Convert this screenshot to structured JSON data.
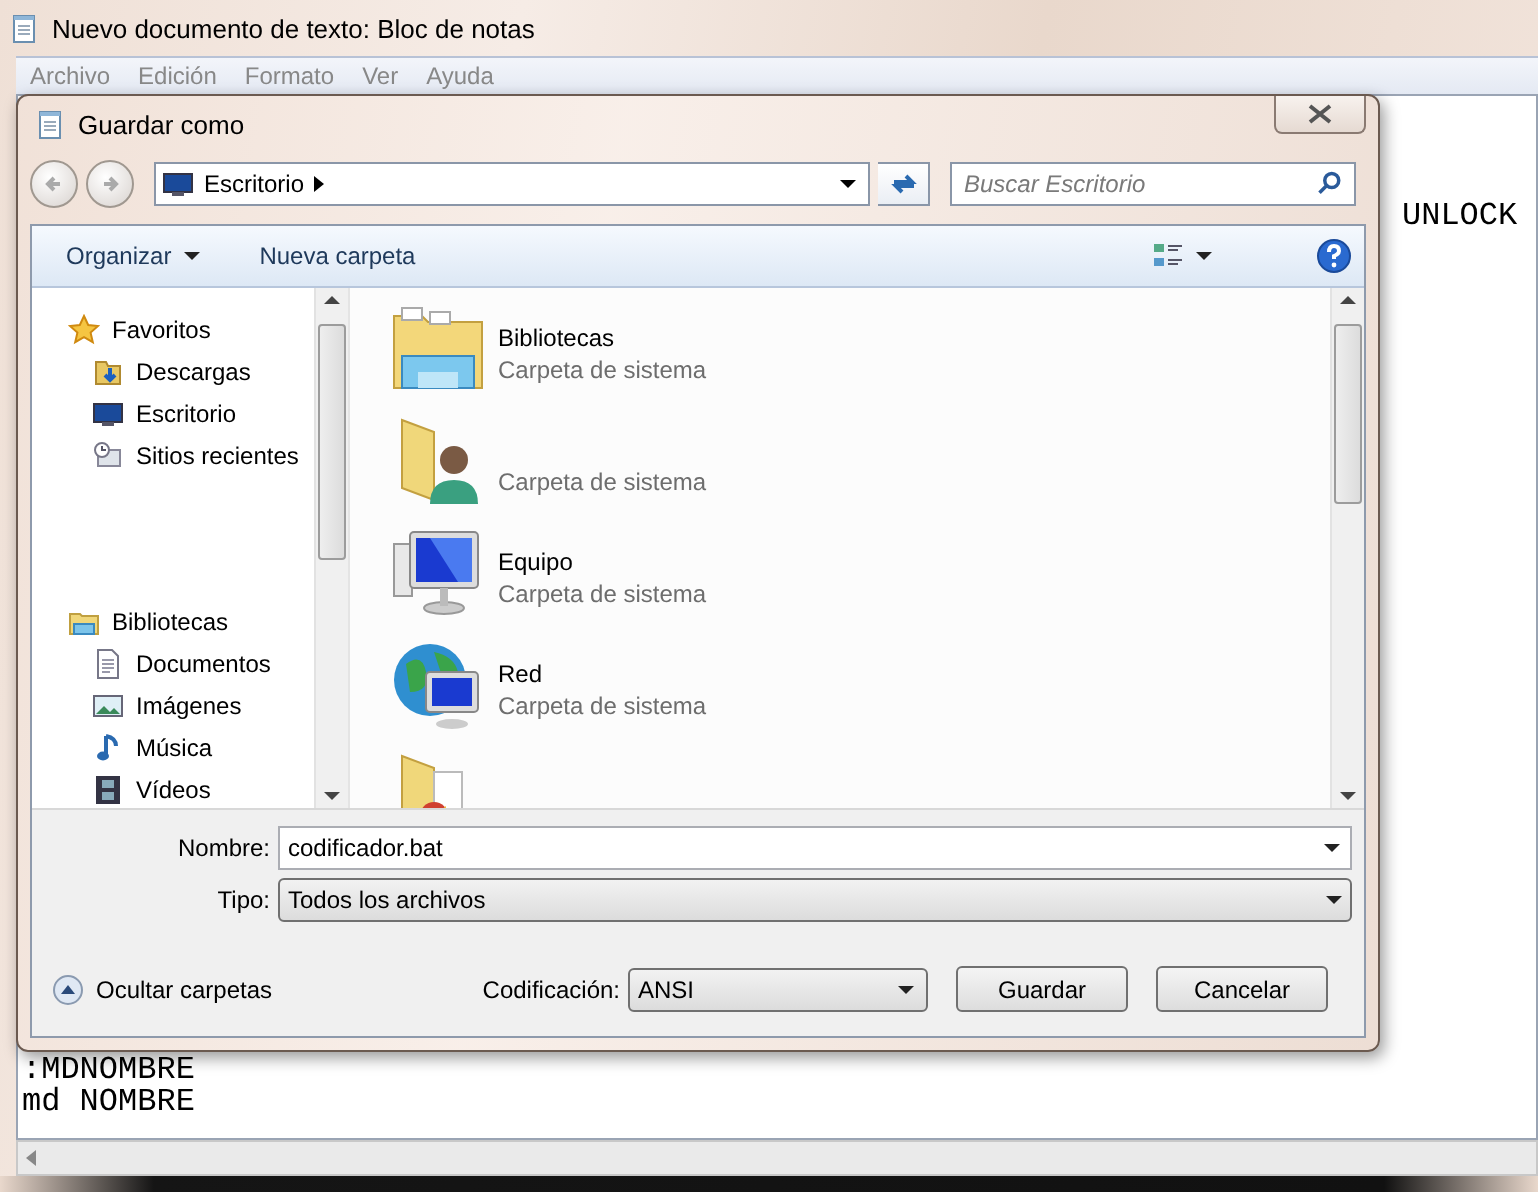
{
  "notepad": {
    "title": "Nuevo documento de texto: Bloc de notas",
    "menu": [
      "Archivo",
      "Edición",
      "Formato",
      "Ver",
      "Ayuda"
    ],
    "lines": [
      "UNLOCK",
      ":MDNOMBRE",
      "md NOMBRE"
    ]
  },
  "dialog": {
    "title": "Guardar como",
    "address": "Escritorio",
    "search": {
      "placeholder": "Buscar Escritorio"
    },
    "toolbar": {
      "organize": "Organizar",
      "new_folder": "Nueva carpeta"
    },
    "nav_groups": [
      {
        "label": "Favoritos",
        "kind": "star",
        "children": [
          {
            "label": "Descargas",
            "kind": "downloads"
          },
          {
            "label": "Escritorio",
            "kind": "desktop"
          },
          {
            "label": "Sitios recientes",
            "kind": "recent"
          }
        ]
      },
      {
        "label": "Bibliotecas",
        "kind": "libraries",
        "children": [
          {
            "label": "Documentos",
            "kind": "documents"
          },
          {
            "label": "Imágenes",
            "kind": "pictures"
          },
          {
            "label": "Música",
            "kind": "music"
          },
          {
            "label": "Vídeos",
            "kind": "videos"
          }
        ]
      }
    ],
    "items": [
      {
        "kind": "libraries",
        "name": "Bibliotecas",
        "subtitle": "Carpeta de sistema"
      },
      {
        "kind": "user",
        "subtitle": "Carpeta de sistema"
      },
      {
        "kind": "computer",
        "name": "Equipo",
        "subtitle": "Carpeta de sistema"
      },
      {
        "kind": "network",
        "name": "Red",
        "subtitle": "Carpeta de sistema"
      },
      {
        "kind": "folder"
      }
    ],
    "fields": [
      {
        "label": "Nombre:",
        "value": "codificador.bat",
        "kind": "combo"
      },
      {
        "label": "Tipo:",
        "value": "Todos los archivos",
        "kind": "select"
      }
    ],
    "hide_folders": "Ocultar carpetas",
    "encoding": {
      "label": "Codificación:",
      "value": "ANSI"
    },
    "buttons": [
      "Guardar",
      "Cancelar"
    ]
  }
}
